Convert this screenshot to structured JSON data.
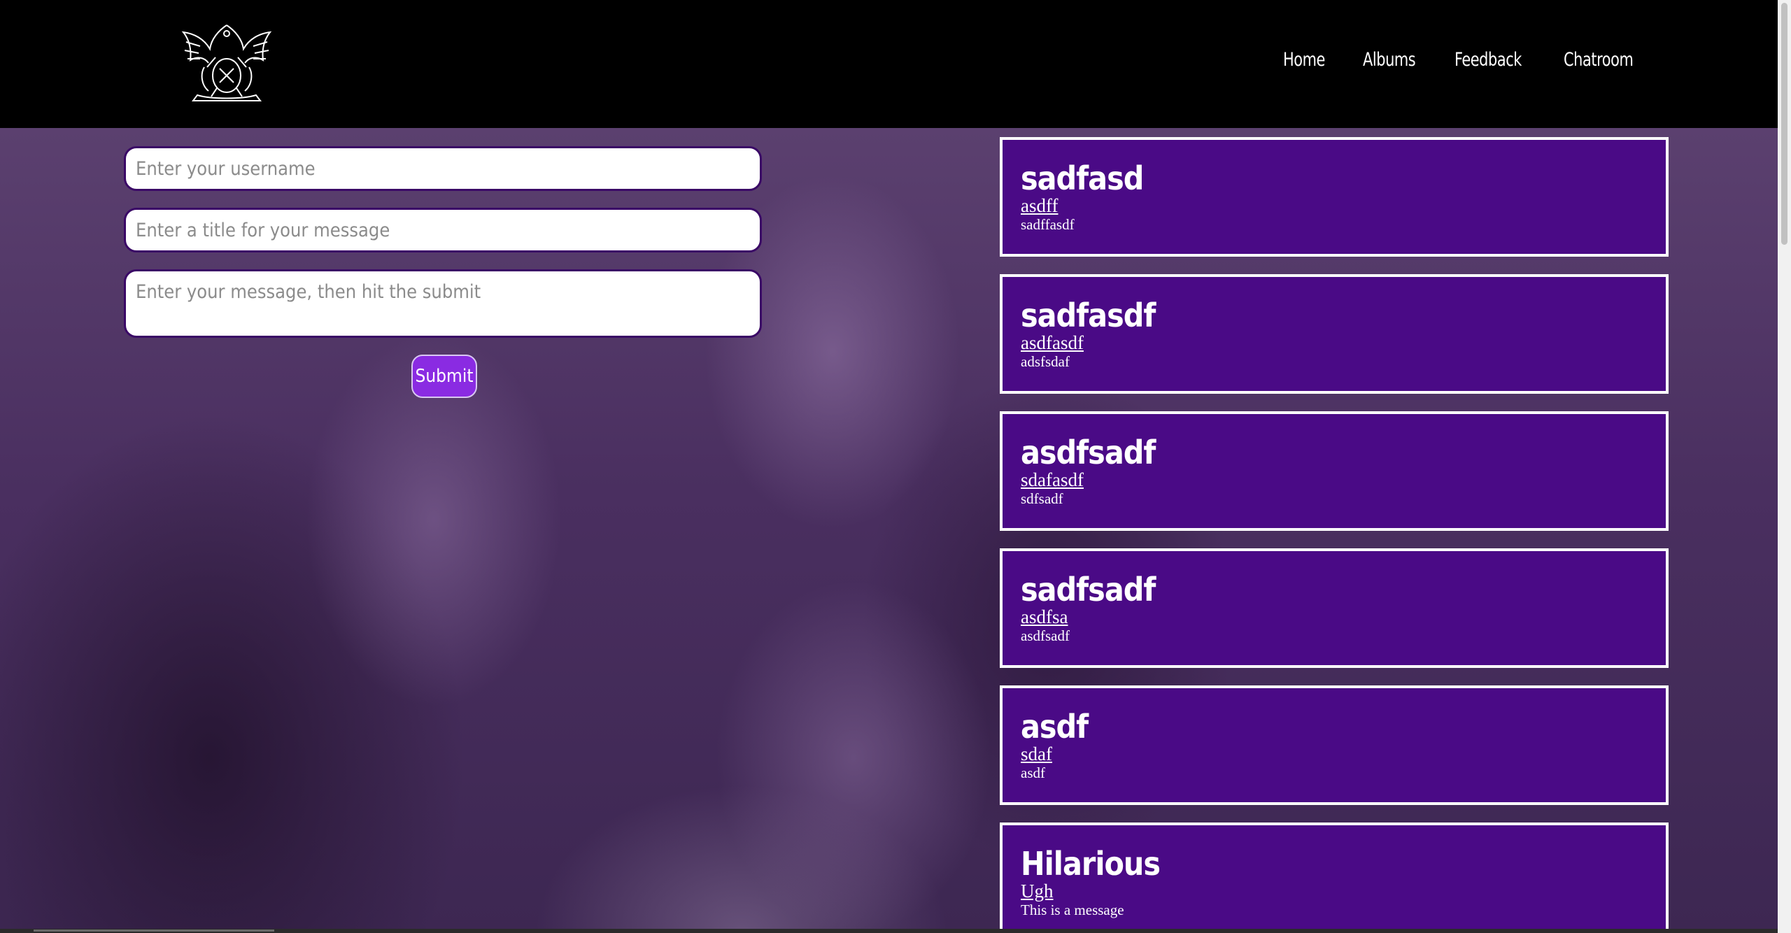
{
  "nav": {
    "items": [
      {
        "label": "Home"
      },
      {
        "label": "Albums"
      },
      {
        "label": "Feedback"
      },
      {
        "label": "Chatroom"
      }
    ]
  },
  "form": {
    "username_placeholder": "Enter your username",
    "title_placeholder": "Enter a title for your message",
    "message_placeholder": "Enter your message, then hit the submit",
    "submit_label": "Submit"
  },
  "messages": [
    {
      "title": "sadfasd",
      "author": "asdff",
      "body": "sadffasdf"
    },
    {
      "title": "sadfasdf",
      "author": "asdfasdf",
      "body": "adsfsdaf"
    },
    {
      "title": "asdfsadf",
      "author": "sdafasdf",
      "body": "sdfsadf"
    },
    {
      "title": "sadfsadf",
      "author": "asdfsa",
      "body": "asdfsadf"
    },
    {
      "title": "asdf",
      "author": "sdaf",
      "body": "asdf"
    },
    {
      "title": "Hilarious",
      "author": "Ugh",
      "body": "This is a message"
    }
  ],
  "colors": {
    "header_bg": "#000000",
    "card_bg": "#4a0a86",
    "submit_bg": "#8a2be2",
    "page_overlay": "#4a2f60"
  },
  "icons": {
    "logo": "queen-crest-logo"
  }
}
